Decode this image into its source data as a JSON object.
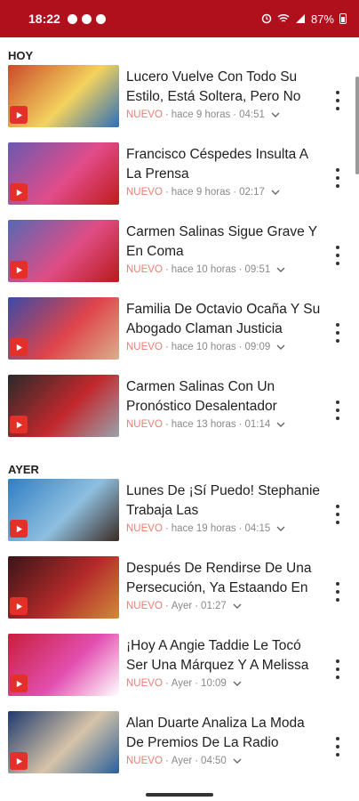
{
  "status_bar": {
    "time": "18:22",
    "battery": "87%",
    "icons": [
      "alarm-icon",
      "wifi-icon",
      "signal-icon",
      "battery-icon"
    ]
  },
  "sections": [
    {
      "label": "HOY",
      "items": [
        {
          "title": "Lucero Vuelve Con Todo Su Estilo, Está Soltera, Pero No",
          "badge": "NUEVO",
          "age": "hace 9 horas",
          "duration": "04:51",
          "thumb_colors": [
            "#c94b2a",
            "#f3d25e",
            "#2d6fb8"
          ]
        },
        {
          "title": "Francisco Céspedes Insulta A La Prensa",
          "badge": "NUEVO",
          "age": "hace 9 horas",
          "duration": "02:17",
          "thumb_colors": [
            "#6a59b0",
            "#e24c8a",
            "#c01b1b"
          ]
        },
        {
          "title": "Carmen Salinas Sigue Grave Y En Coma",
          "badge": "NUEVO",
          "age": "hace 10 horas",
          "duration": "09:51",
          "thumb_colors": [
            "#5568b5",
            "#e04d85",
            "#b81a1a"
          ]
        },
        {
          "title": "Familia De Octavio Ocaña Y Su Abogado Claman Justicia",
          "badge": "NUEVO",
          "age": "hace 10 horas",
          "duration": "09:09",
          "thumb_colors": [
            "#3b4aa8",
            "#e0444a",
            "#d9b08c"
          ]
        },
        {
          "title": "Carmen Salinas Con Un Pronóstico Desalentador",
          "badge": "NUEVO",
          "age": "hace 13 horas",
          "duration": "01:14",
          "thumb_colors": [
            "#2a2a2a",
            "#c2282d",
            "#9aa3ad"
          ]
        }
      ]
    },
    {
      "label": "AYER",
      "items": [
        {
          "title": "Lunes De ¡Sí Puedo! Stephanie Trabaja Las",
          "badge": "NUEVO",
          "age": "hace 19 horas",
          "duration": "04:15",
          "thumb_colors": [
            "#2f7fc4",
            "#8fbfe0",
            "#3a2a22"
          ]
        },
        {
          "title": "Después De Rendirse De Una Persecución, Ya Estaando En",
          "badge": "NUEVO",
          "age": "Ayer",
          "duration": "01:27",
          "thumb_colors": [
            "#3a1518",
            "#b42a2a",
            "#d08a3a"
          ]
        },
        {
          "title": "¡Hoy A Angie Taddie Le Tocó Ser Una Márquez Y A Melissa",
          "badge": "NUEVO",
          "age": "Ayer",
          "duration": "10:09",
          "thumb_colors": [
            "#c81e3c",
            "#e34fb0",
            "#ffffff"
          ]
        },
        {
          "title": "Alan Duarte Analiza La Moda De Premios De La Radio",
          "badge": "NUEVO",
          "age": "Ayer",
          "duration": "04:50",
          "thumb_colors": [
            "#1f3a6e",
            "#d7c4a8",
            "#2a5f9a"
          ]
        }
      ]
    }
  ],
  "colors": {
    "brand": "#b0101c",
    "badge": "#f07b72",
    "play": "#e5302a"
  }
}
